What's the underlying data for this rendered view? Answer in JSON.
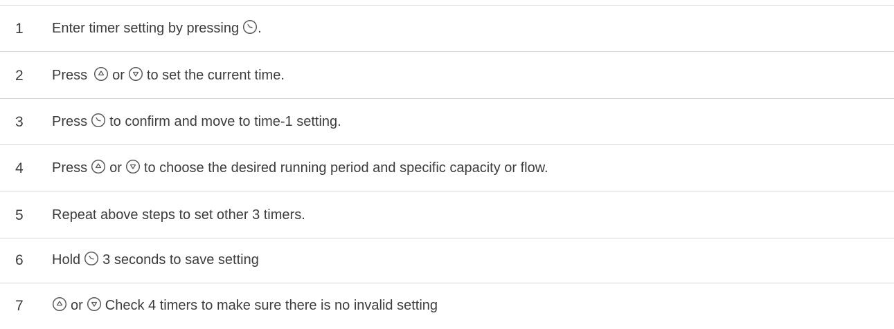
{
  "steps": [
    {
      "number": "1",
      "parts": [
        "Enter timer setting by pressing",
        "."
      ]
    },
    {
      "number": "2",
      "parts": [
        "Press",
        "or",
        "to set the current time."
      ]
    },
    {
      "number": "3",
      "parts": [
        "Press",
        "to confirm and move to time-1 setting."
      ]
    },
    {
      "number": "4",
      "parts": [
        "Press",
        "or",
        "to choose the desired running period and specific capacity or flow."
      ]
    },
    {
      "number": "5",
      "parts": [
        "Repeat above steps to set other 3 timers."
      ]
    },
    {
      "number": "6",
      "parts": [
        "Hold",
        "3 seconds to save setting"
      ]
    },
    {
      "number": "7",
      "parts": [
        "or",
        "Check 4 timers to make sure there is no invalid setting"
      ]
    }
  ],
  "icons": {
    "clock": "clock-icon",
    "up": "up-arrow-icon",
    "down": "down-arrow-icon"
  },
  "colors": {
    "text": "#3c3c3c",
    "rule": "#d6d6d6",
    "icon": "#5a5a5a"
  }
}
